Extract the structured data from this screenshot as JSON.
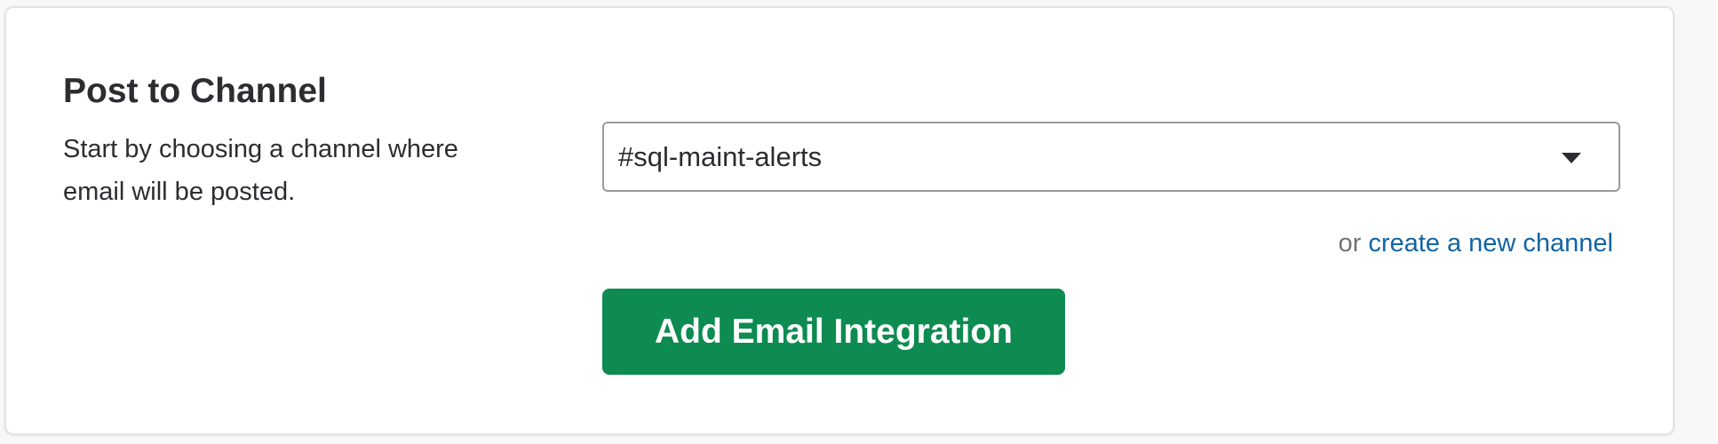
{
  "section": {
    "title": "Post to Channel",
    "description": "Start by choosing a channel where email will be posted."
  },
  "channel_select": {
    "selected_value": "#sql-maint-alerts",
    "icon": "caret-down-icon"
  },
  "create_channel": {
    "prefix": "or",
    "link_label": "create a new channel"
  },
  "actions": {
    "add_label": "Add Email Integration"
  },
  "colors": {
    "button_bg": "#0d8b51",
    "link": "#1264a3",
    "text": "#2c2d30",
    "muted": "#717274"
  }
}
